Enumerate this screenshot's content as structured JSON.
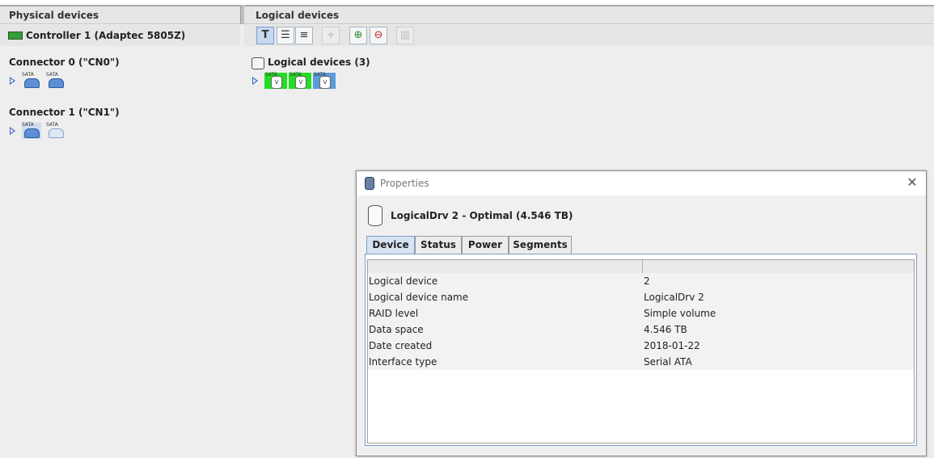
{
  "physical": {
    "header": "Physical devices",
    "controller": "Controller 1 (Adaptec 5805Z)",
    "connectors": [
      {
        "title": "Connector 0 (\"CN0\")",
        "disk_tag": "SATA"
      },
      {
        "title": "Connector 1 (\"CN1\")",
        "disk_tag": "SATA"
      }
    ]
  },
  "logical": {
    "header": "Logical devices",
    "group_title": "Logical devices (3)",
    "disk_tag": "SATA",
    "disk_letter": "V",
    "colors": {
      "optimal": "#22dd22",
      "selected": "#5b9bd9"
    }
  },
  "toolbar": {
    "buttons": [
      {
        "name": "text-view-button",
        "glyph": "T"
      },
      {
        "name": "list-view-button",
        "glyph": "☰"
      },
      {
        "name": "detail-view-button",
        "glyph": "≡"
      },
      {
        "name": "add-button",
        "glyph": "+"
      },
      {
        "name": "create-logical-button",
        "glyph": "⊕"
      },
      {
        "name": "delete-logical-button",
        "glyph": "⊖"
      },
      {
        "name": "tasks-button",
        "glyph": "▥"
      }
    ]
  },
  "dialog": {
    "title": "Properties",
    "close_glyph": "✕",
    "device_heading": "LogicalDrv 2 - Optimal (4.546 TB)",
    "tabs": [
      "Device",
      "Status",
      "Power",
      "Segments"
    ],
    "table": [
      {
        "key": "Logical device",
        "value": "2"
      },
      {
        "key": "Logical device name",
        "value": "LogicalDrv 2"
      },
      {
        "key": "RAID level",
        "value": "Simple volume"
      },
      {
        "key": "Data space",
        "value": "4.546 TB"
      },
      {
        "key": "Date created",
        "value": "2018-01-22"
      },
      {
        "key": "Interface type",
        "value": "Serial ATA"
      }
    ]
  }
}
